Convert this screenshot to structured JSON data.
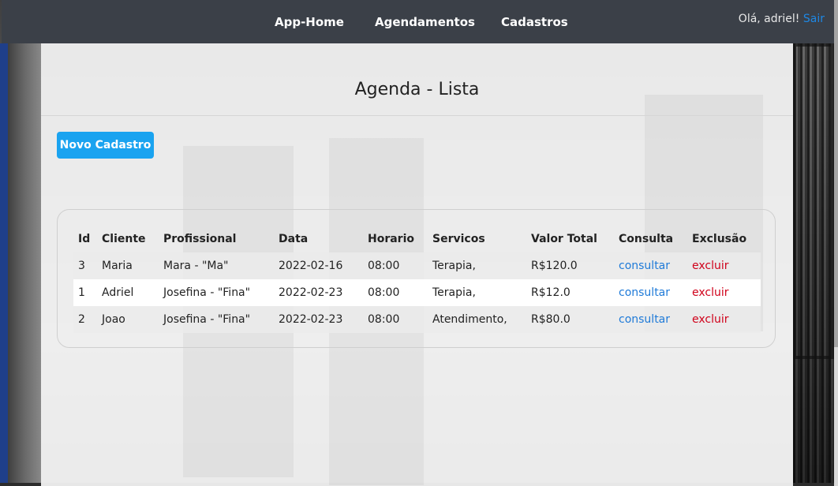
{
  "nav": {
    "items": [
      {
        "label": "App-Home"
      },
      {
        "label": "Agendamentos"
      },
      {
        "label": "Cadastros"
      }
    ],
    "greeting": "Olá, adriel!",
    "logout": "Sair"
  },
  "main": {
    "title": "Agenda - Lista",
    "new_button": "Novo Cadastro",
    "table": {
      "headers": [
        "Id",
        "Cliente",
        "Profissional",
        "Data",
        "Horario",
        "Servicos",
        "Valor Total",
        "Consulta",
        "Exclusão"
      ],
      "rows": [
        {
          "id": "3",
          "cliente": "Maria",
          "profissional": "Mara - \"Ma\"",
          "data": "2022-02-16",
          "horario": "08:00",
          "servicos": "Terapia,",
          "valor": "R$120.0",
          "consulta": "consultar",
          "exclusao": "excluir"
        },
        {
          "id": "1",
          "cliente": "Adriel",
          "profissional": "Josefina - \"Fina\"",
          "data": "2022-02-23",
          "horario": "08:00",
          "servicos": "Terapia,",
          "valor": "R$12.0",
          "consulta": "consultar",
          "exclusao": "excluir"
        },
        {
          "id": "2",
          "cliente": "Joao",
          "profissional": "Josefina - \"Fina\"",
          "data": "2022-02-23",
          "horario": "08:00",
          "servicos": "Atendimento,",
          "valor": "R$80.0",
          "consulta": "consultar",
          "exclusao": "excluir"
        }
      ]
    }
  },
  "colors": {
    "nav_bg": "#3b4048",
    "accent_button": "#1aa3f0",
    "link_blue": "#1e7ad8",
    "delete_red": "#d0021b"
  }
}
